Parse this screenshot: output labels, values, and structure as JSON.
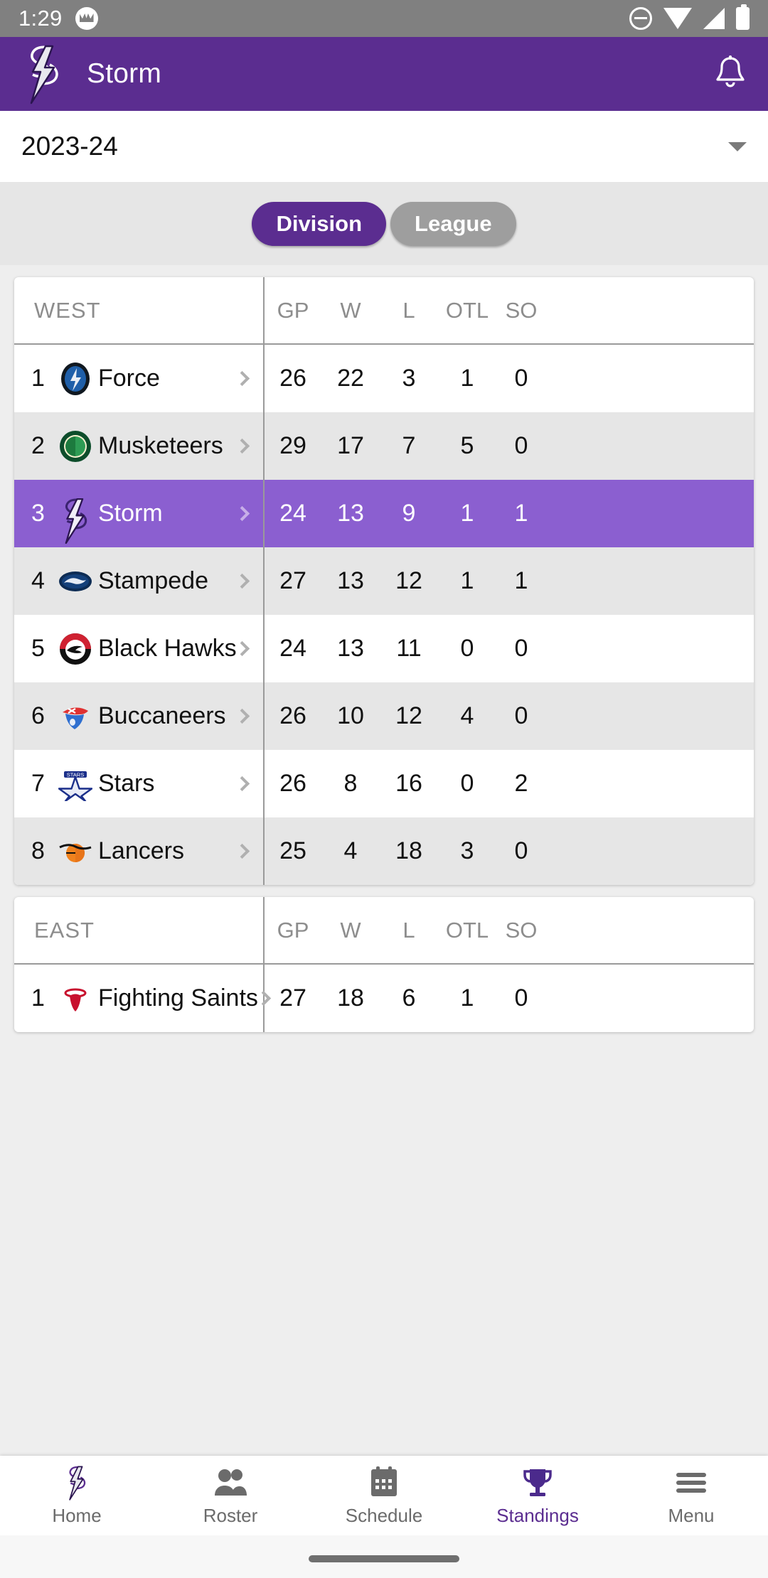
{
  "status_bar": {
    "time": "1:29",
    "icons": [
      "app-notification-icon",
      "do-not-disturb-icon",
      "wifi-icon",
      "cellular-signal-icon",
      "battery-icon"
    ]
  },
  "app_bar": {
    "title": "Storm",
    "logo_name": "storm-team-logo",
    "notification_icon": "bell-icon"
  },
  "season_selector": {
    "value": "2023-24",
    "caret_icon": "chevron-down-icon"
  },
  "segmented_control": {
    "options": [
      {
        "label": "Division",
        "active": true
      },
      {
        "label": "League",
        "active": false
      }
    ],
    "active_color": "#5B2D90",
    "inactive_color": "#9E9E9E"
  },
  "standings": {
    "columns": [
      "GP",
      "W",
      "L",
      "OTL",
      "SO"
    ],
    "highlight_color": "#8B5FD0",
    "groups": [
      {
        "name": "WEST",
        "rows": [
          {
            "rank": "1",
            "team": "Force",
            "logo": "force-logo",
            "GP": "26",
            "W": "22",
            "L": "3",
            "OTL": "1",
            "SO": "0",
            "highlighted": false
          },
          {
            "rank": "2",
            "team": "Musketeers",
            "logo": "musketeers-logo",
            "GP": "29",
            "W": "17",
            "L": "7",
            "OTL": "5",
            "SO": "0",
            "highlighted": false
          },
          {
            "rank": "3",
            "team": "Storm",
            "logo": "storm-logo",
            "GP": "24",
            "W": "13",
            "L": "9",
            "OTL": "1",
            "SO": "1",
            "highlighted": true
          },
          {
            "rank": "4",
            "team": "Stampede",
            "logo": "stampede-logo",
            "GP": "27",
            "W": "13",
            "L": "12",
            "OTL": "1",
            "SO": "1",
            "highlighted": false
          },
          {
            "rank": "5",
            "team": "Black Hawks",
            "logo": "black-hawks-logo",
            "GP": "24",
            "W": "13",
            "L": "11",
            "OTL": "0",
            "SO": "0",
            "highlighted": false
          },
          {
            "rank": "6",
            "team": "Buccaneers",
            "logo": "buccaneers-logo",
            "GP": "26",
            "W": "10",
            "L": "12",
            "OTL": "4",
            "SO": "0",
            "highlighted": false
          },
          {
            "rank": "7",
            "team": "Stars",
            "logo": "stars-logo",
            "GP": "26",
            "W": "8",
            "L": "16",
            "OTL": "0",
            "SO": "2",
            "highlighted": false
          },
          {
            "rank": "8",
            "team": "Lancers",
            "logo": "lancers-logo",
            "GP": "25",
            "W": "4",
            "L": "18",
            "OTL": "3",
            "SO": "0",
            "highlighted": false
          }
        ]
      },
      {
        "name": "EAST",
        "rows": [
          {
            "rank": "1",
            "team": "Fighting Saints",
            "logo": "fighting-saints-logo",
            "GP": "27",
            "W": "18",
            "L": "6",
            "OTL": "1",
            "SO": "0",
            "highlighted": false
          }
        ]
      }
    ]
  },
  "bottom_nav": {
    "items": [
      {
        "label": "Home",
        "icon": "storm-logo-icon",
        "active": false
      },
      {
        "label": "Roster",
        "icon": "people-icon",
        "active": false
      },
      {
        "label": "Schedule",
        "icon": "calendar-icon",
        "active": false
      },
      {
        "label": "Standings",
        "icon": "trophy-icon",
        "active": true
      },
      {
        "label": "Menu",
        "icon": "hamburger-icon",
        "active": false
      }
    ]
  }
}
